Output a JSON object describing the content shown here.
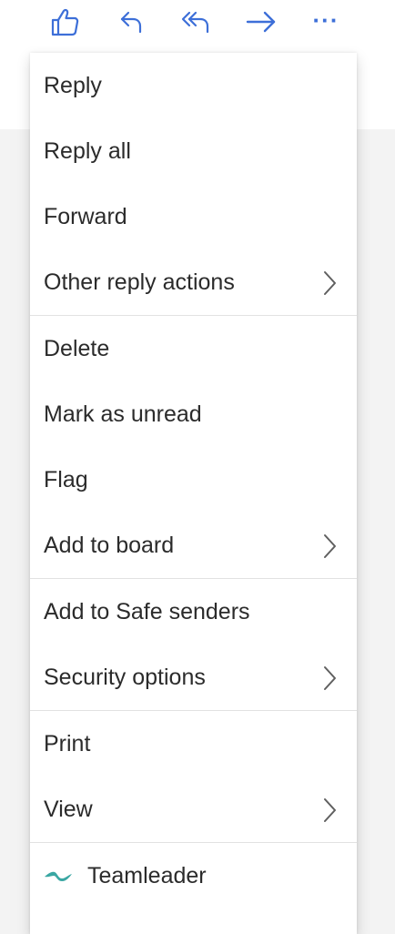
{
  "toolbar": {
    "buttons": [
      {
        "name": "like",
        "icon": "thumbs-up-icon"
      },
      {
        "name": "reply",
        "icon": "reply-icon"
      },
      {
        "name": "reply-all",
        "icon": "reply-all-icon"
      },
      {
        "name": "forward",
        "icon": "forward-arrow-icon"
      },
      {
        "name": "more",
        "icon": "more-ellipsis-icon"
      }
    ],
    "more_glyph": "···",
    "icon_color": "#3d6fd8"
  },
  "menu": {
    "groups": [
      {
        "items": [
          {
            "label": "Reply",
            "submenu": false
          },
          {
            "label": "Reply all",
            "submenu": false
          },
          {
            "label": "Forward",
            "submenu": false
          },
          {
            "label": "Other reply actions",
            "submenu": true
          }
        ]
      },
      {
        "items": [
          {
            "label": "Delete",
            "submenu": false
          },
          {
            "label": "Mark as unread",
            "submenu": false
          },
          {
            "label": "Flag",
            "submenu": false
          },
          {
            "label": "Add to board",
            "submenu": true
          }
        ]
      },
      {
        "items": [
          {
            "label": "Add to Safe senders",
            "submenu": false
          },
          {
            "label": "Security options",
            "submenu": true
          }
        ]
      },
      {
        "items": [
          {
            "label": "Print",
            "submenu": false
          },
          {
            "label": "View",
            "submenu": true
          }
        ]
      },
      {
        "items": [
          {
            "label": "Teamleader",
            "submenu": false,
            "icon": "teamleader-logo-icon"
          }
        ]
      }
    ],
    "addin_icon_color": "#3aa7a3"
  }
}
